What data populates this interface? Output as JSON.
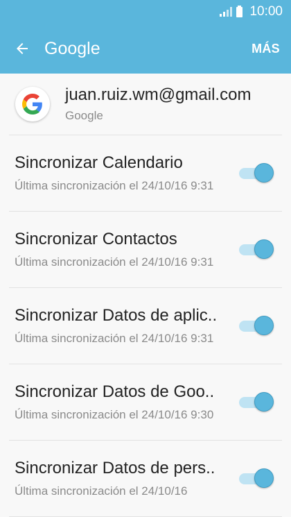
{
  "status_bar": {
    "time": "10:00"
  },
  "app_bar": {
    "title": "Google",
    "more_label": "MÁS"
  },
  "account": {
    "email": "juan.ruiz.wm@gmail.com",
    "provider": "Google"
  },
  "sync_items": [
    {
      "title": "Sincronizar Calendario",
      "subtitle": "Última sincronización el 24/10/16 9:31",
      "enabled": true
    },
    {
      "title": "Sincronizar Contactos",
      "subtitle": "Última sincronización el 24/10/16 9:31",
      "enabled": true
    },
    {
      "title": "Sincronizar Datos de aplic..",
      "subtitle": "Última sincronización el 24/10/16 9:31",
      "enabled": true
    },
    {
      "title": "Sincronizar Datos de Goo..",
      "subtitle": "Última sincronización el 24/10/16 9:30",
      "enabled": true
    },
    {
      "title": "Sincronizar Datos de pers..",
      "subtitle": "Última sincronización el 24/10/16",
      "enabled": true
    }
  ],
  "colors": {
    "accent": "#5ab6dc",
    "track": "#bfe3f3",
    "background": "#f8f8f8"
  }
}
